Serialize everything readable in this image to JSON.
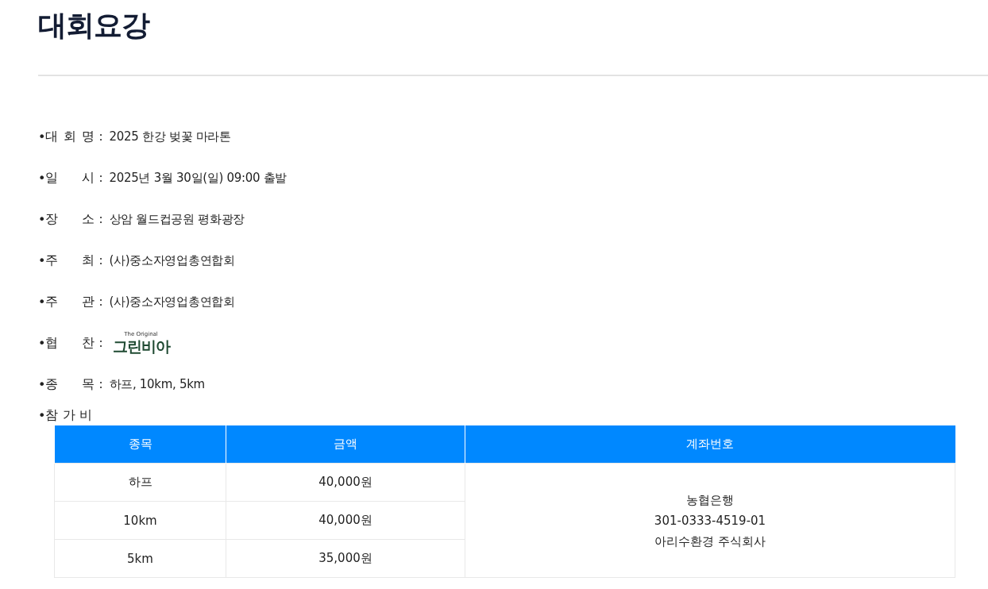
{
  "title": "대회요강",
  "items": [
    {
      "kind": "text",
      "bullet": "•",
      "label": "대 회 명",
      "colon": ":",
      "value": "2025 한강 벚꽃 마라톤"
    },
    {
      "kind": "text",
      "bullet": "•",
      "label": "일 시",
      "colon": ":",
      "value": "2025년 3월 30일(일) 09:00 출발"
    },
    {
      "kind": "text",
      "bullet": "•",
      "label": "장 소",
      "colon": ":",
      "value": "상암 월드컵공원 평화광장"
    },
    {
      "kind": "text",
      "bullet": "•",
      "label": "주 최",
      "colon": ":",
      "value": "(사)중소자영업총연합회"
    },
    {
      "kind": "text",
      "bullet": "•",
      "label": "주 관",
      "colon": ":",
      "value": "(사)중소자영업총연합회"
    },
    {
      "kind": "logo",
      "bullet": "•",
      "label": "협 찬",
      "colon": ":",
      "logo_small": "The Original",
      "logo_main": "그린비아"
    },
    {
      "kind": "text",
      "bullet": "•",
      "label": "종 목",
      "colon": ":",
      "value": "하프, 10km, 5km"
    }
  ],
  "fee": {
    "bullet": "•",
    "label": "참 가 비",
    "table": {
      "columns": [
        "종목",
        "금액",
        "계좌번호"
      ],
      "rows": [
        {
          "event": "하프",
          "amount": "40,000원"
        },
        {
          "event": "10km",
          "amount": "40,000원"
        },
        {
          "event": "5km",
          "amount": "35,000원"
        }
      ],
      "account": [
        "농협은행",
        "301-0333-4519-01",
        "아리수환경 주식회사"
      ]
    }
  }
}
